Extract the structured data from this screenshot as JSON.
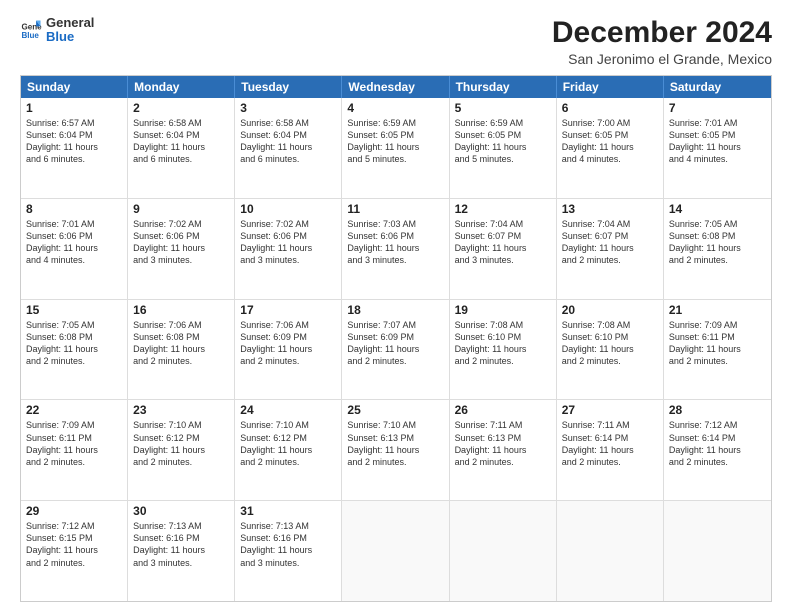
{
  "logo": {
    "line1": "General",
    "line2": "Blue"
  },
  "title": "December 2024",
  "subtitle": "San Jeronimo el Grande, Mexico",
  "header_days": [
    "Sunday",
    "Monday",
    "Tuesday",
    "Wednesday",
    "Thursday",
    "Friday",
    "Saturday"
  ],
  "weeks": [
    [
      {
        "day": "1",
        "text": "Sunrise: 6:57 AM\nSunset: 6:04 PM\nDaylight: 11 hours\nand 6 minutes."
      },
      {
        "day": "2",
        "text": "Sunrise: 6:58 AM\nSunset: 6:04 PM\nDaylight: 11 hours\nand 6 minutes."
      },
      {
        "day": "3",
        "text": "Sunrise: 6:58 AM\nSunset: 6:04 PM\nDaylight: 11 hours\nand 6 minutes."
      },
      {
        "day": "4",
        "text": "Sunrise: 6:59 AM\nSunset: 6:05 PM\nDaylight: 11 hours\nand 5 minutes."
      },
      {
        "day": "5",
        "text": "Sunrise: 6:59 AM\nSunset: 6:05 PM\nDaylight: 11 hours\nand 5 minutes."
      },
      {
        "day": "6",
        "text": "Sunrise: 7:00 AM\nSunset: 6:05 PM\nDaylight: 11 hours\nand 4 minutes."
      },
      {
        "day": "7",
        "text": "Sunrise: 7:01 AM\nSunset: 6:05 PM\nDaylight: 11 hours\nand 4 minutes."
      }
    ],
    [
      {
        "day": "8",
        "text": "Sunrise: 7:01 AM\nSunset: 6:06 PM\nDaylight: 11 hours\nand 4 minutes."
      },
      {
        "day": "9",
        "text": "Sunrise: 7:02 AM\nSunset: 6:06 PM\nDaylight: 11 hours\nand 3 minutes."
      },
      {
        "day": "10",
        "text": "Sunrise: 7:02 AM\nSunset: 6:06 PM\nDaylight: 11 hours\nand 3 minutes."
      },
      {
        "day": "11",
        "text": "Sunrise: 7:03 AM\nSunset: 6:06 PM\nDaylight: 11 hours\nand 3 minutes."
      },
      {
        "day": "12",
        "text": "Sunrise: 7:04 AM\nSunset: 6:07 PM\nDaylight: 11 hours\nand 3 minutes."
      },
      {
        "day": "13",
        "text": "Sunrise: 7:04 AM\nSunset: 6:07 PM\nDaylight: 11 hours\nand 2 minutes."
      },
      {
        "day": "14",
        "text": "Sunrise: 7:05 AM\nSunset: 6:08 PM\nDaylight: 11 hours\nand 2 minutes."
      }
    ],
    [
      {
        "day": "15",
        "text": "Sunrise: 7:05 AM\nSunset: 6:08 PM\nDaylight: 11 hours\nand 2 minutes."
      },
      {
        "day": "16",
        "text": "Sunrise: 7:06 AM\nSunset: 6:08 PM\nDaylight: 11 hours\nand 2 minutes."
      },
      {
        "day": "17",
        "text": "Sunrise: 7:06 AM\nSunset: 6:09 PM\nDaylight: 11 hours\nand 2 minutes."
      },
      {
        "day": "18",
        "text": "Sunrise: 7:07 AM\nSunset: 6:09 PM\nDaylight: 11 hours\nand 2 minutes."
      },
      {
        "day": "19",
        "text": "Sunrise: 7:08 AM\nSunset: 6:10 PM\nDaylight: 11 hours\nand 2 minutes."
      },
      {
        "day": "20",
        "text": "Sunrise: 7:08 AM\nSunset: 6:10 PM\nDaylight: 11 hours\nand 2 minutes."
      },
      {
        "day": "21",
        "text": "Sunrise: 7:09 AM\nSunset: 6:11 PM\nDaylight: 11 hours\nand 2 minutes."
      }
    ],
    [
      {
        "day": "22",
        "text": "Sunrise: 7:09 AM\nSunset: 6:11 PM\nDaylight: 11 hours\nand 2 minutes."
      },
      {
        "day": "23",
        "text": "Sunrise: 7:10 AM\nSunset: 6:12 PM\nDaylight: 11 hours\nand 2 minutes."
      },
      {
        "day": "24",
        "text": "Sunrise: 7:10 AM\nSunset: 6:12 PM\nDaylight: 11 hours\nand 2 minutes."
      },
      {
        "day": "25",
        "text": "Sunrise: 7:10 AM\nSunset: 6:13 PM\nDaylight: 11 hours\nand 2 minutes."
      },
      {
        "day": "26",
        "text": "Sunrise: 7:11 AM\nSunset: 6:13 PM\nDaylight: 11 hours\nand 2 minutes."
      },
      {
        "day": "27",
        "text": "Sunrise: 7:11 AM\nSunset: 6:14 PM\nDaylight: 11 hours\nand 2 minutes."
      },
      {
        "day": "28",
        "text": "Sunrise: 7:12 AM\nSunset: 6:14 PM\nDaylight: 11 hours\nand 2 minutes."
      }
    ],
    [
      {
        "day": "29",
        "text": "Sunrise: 7:12 AM\nSunset: 6:15 PM\nDaylight: 11 hours\nand 2 minutes."
      },
      {
        "day": "30",
        "text": "Sunrise: 7:13 AM\nSunset: 6:16 PM\nDaylight: 11 hours\nand 3 minutes."
      },
      {
        "day": "31",
        "text": "Sunrise: 7:13 AM\nSunset: 6:16 PM\nDaylight: 11 hours\nand 3 minutes."
      },
      {
        "day": "",
        "text": ""
      },
      {
        "day": "",
        "text": ""
      },
      {
        "day": "",
        "text": ""
      },
      {
        "day": "",
        "text": ""
      }
    ]
  ]
}
